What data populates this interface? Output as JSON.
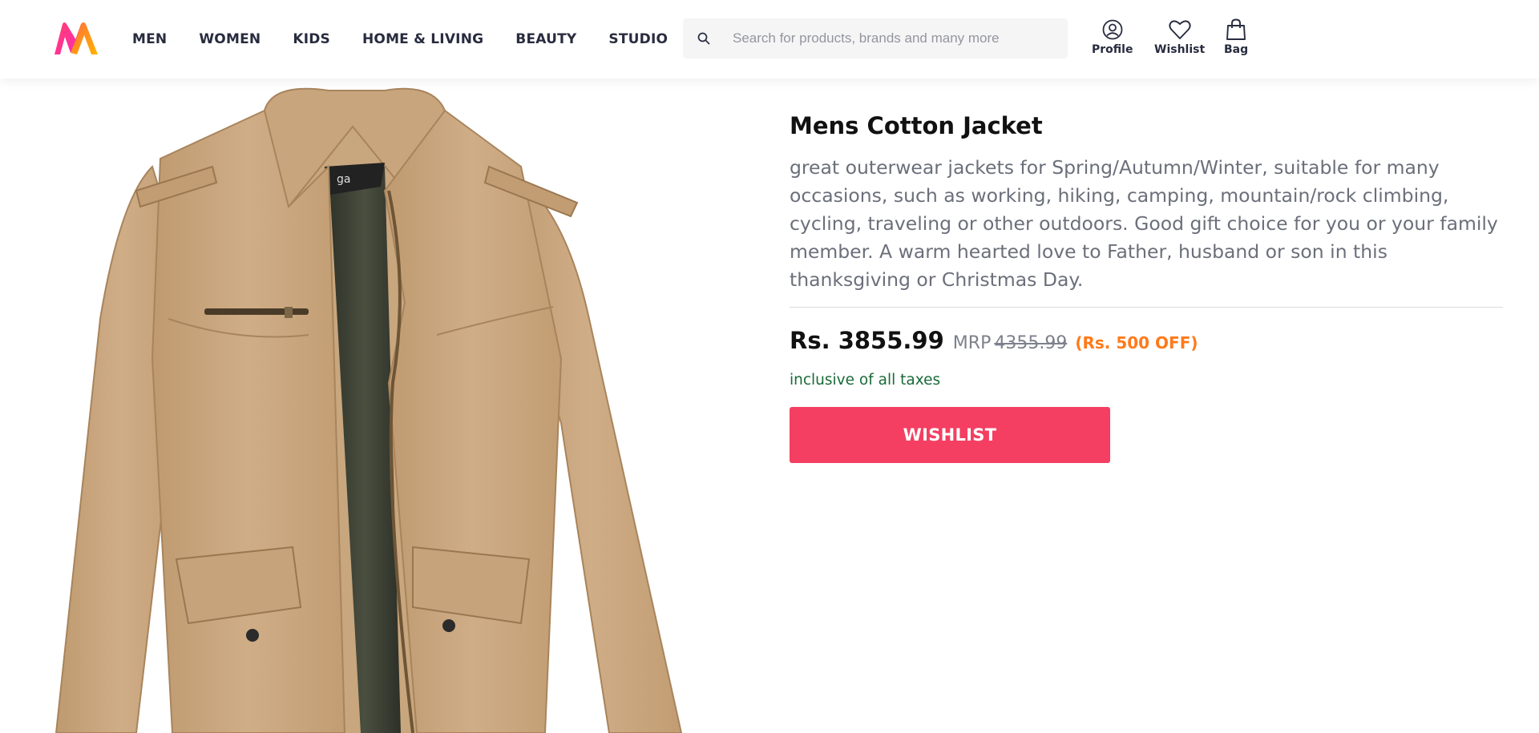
{
  "header": {
    "nav": [
      "MEN",
      "WOMEN",
      "KIDS",
      "HOME & LIVING",
      "BEAUTY",
      "STUDIO"
    ],
    "search": {
      "placeholder": "Search for products, brands and many more"
    },
    "actions": {
      "profile": "Profile",
      "wishlist": "Wishlist",
      "bag": "Bag"
    }
  },
  "product": {
    "title": "Mens Cotton Jacket",
    "description": "great outerwear jackets for Spring/Autumn/Winter, suitable for many occasions, such as working, hiking, camping, mountain/rock climbing, cycling, traveling or other outdoors. Good gift choice for you or your family member. A warm hearted love to Father, husband or son in this thanksgiving or Christmas Day.",
    "price": "Rs. 3855.99",
    "mrp_label": "MRP",
    "mrp": "4355.99",
    "discount": "(Rs. 500 OFF)",
    "tax_note": "inclusive of all taxes",
    "wishlist_button": "WISHLIST",
    "image_alt": "khaki cotton jacket"
  },
  "colors": {
    "accent": "#f43f62",
    "discount": "#ff7a1a",
    "tax_note": "#1a6a38",
    "jacket": "#c9a57d"
  }
}
